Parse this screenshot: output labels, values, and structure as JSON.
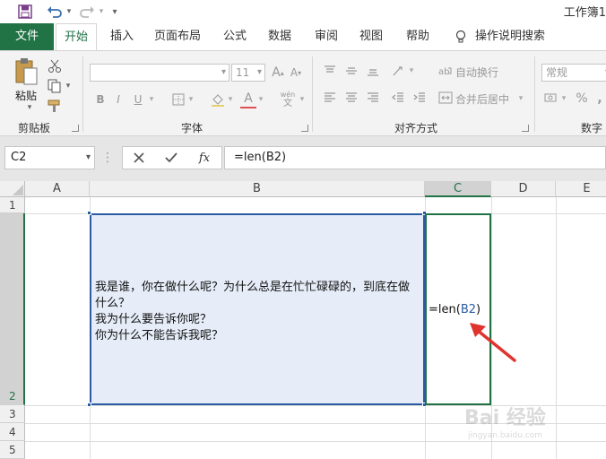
{
  "window": {
    "title": "工作簿1"
  },
  "quick_access": {
    "save_icon": "save-icon",
    "undo_icon": "undo-icon",
    "redo_icon": "redo-icon",
    "customize_icon": "customize-icon"
  },
  "tabs": [
    {
      "id": "file",
      "label": "文件"
    },
    {
      "id": "home",
      "label": "开始"
    },
    {
      "id": "insert",
      "label": "插入"
    },
    {
      "id": "layout",
      "label": "页面布局"
    },
    {
      "id": "formulas",
      "label": "公式"
    },
    {
      "id": "data",
      "label": "数据"
    },
    {
      "id": "review",
      "label": "审阅"
    },
    {
      "id": "view",
      "label": "视图"
    },
    {
      "id": "help",
      "label": "帮助"
    }
  ],
  "tell_me": {
    "label": "操作说明搜索"
  },
  "ribbon": {
    "clipboard": {
      "label": "剪贴板",
      "paste_label": "粘贴"
    },
    "font": {
      "label": "字体",
      "font_name": "",
      "font_size": "11",
      "bold": "B",
      "italic": "I",
      "underline": "U",
      "phonetic": "wén"
    },
    "alignment": {
      "label": "对齐方式",
      "wrap_text": "自动换行",
      "merge_center": "合并后居中"
    },
    "number": {
      "label": "数字",
      "format": "常规",
      "percent": "%",
      "comma": ","
    }
  },
  "formula_bar": {
    "name_box": "C2",
    "fx": "fx",
    "formula": "=len(B2)"
  },
  "grid": {
    "columns": [
      "A",
      "B",
      "C",
      "D",
      "E"
    ],
    "rows": [
      "1",
      "2",
      "3",
      "4",
      "5"
    ],
    "b2_text": "我是谁，你在做什么呢？为什么总是在忙忙碌碌的，到底在做什么？\n我为什么要告诉你呢？\n你为什么不能告诉我呢？",
    "c2_prefix": "=len(",
    "c2_ref": "B2",
    "c2_suffix": ")"
  },
  "watermark": {
    "text": "Bai 经验",
    "sub": "jingyan.baidu.com"
  },
  "colors": {
    "accent": "#217346",
    "selection": "#2a5ba4",
    "annotation": "#e0342f"
  }
}
